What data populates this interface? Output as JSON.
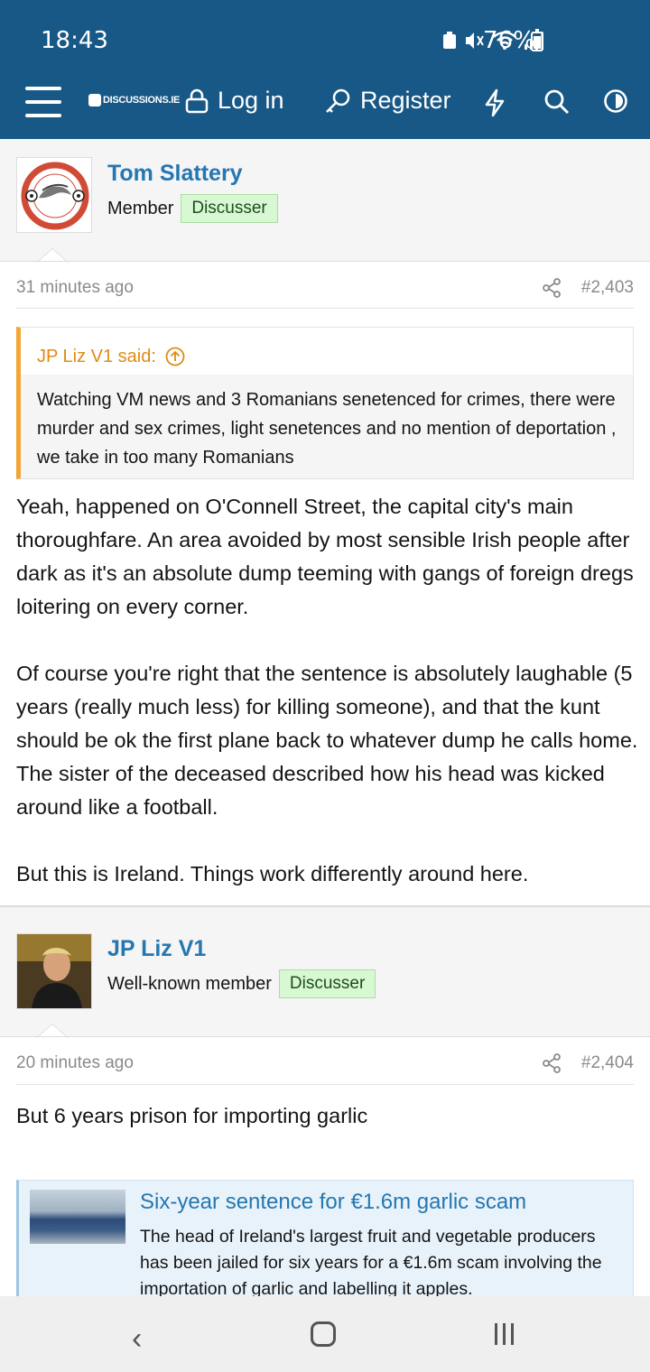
{
  "status_bar": {
    "time": "18:43",
    "battery": "76%"
  },
  "nav": {
    "brand": "DISCUSSIONS.IE",
    "login": "Log in",
    "register": "Register"
  },
  "posts": [
    {
      "username": "Tom Slattery",
      "role": "Member",
      "badge": "Discusser",
      "time": "31 minutes ago",
      "number": "#2,403",
      "quote": {
        "author": "JP Liz V1 said:",
        "text": "Watching VM news and 3 Romanians senetenced for crimes, there were murder and sex crimes, light senetences and no mention of deportation , we take in too many Romanians"
      },
      "paragraphs": [
        "Yeah, happened on O'Connell Street, the capital city's main thoroughfare. An area avoided by most sensible Irish people after dark as it's an absolute dump teeming with gangs of foreign dregs loitering on every corner.",
        "Of course you're right that the sentence is absolutely laughable (5 years (really much less) for killing someone), and that the kunt should be ok the first plane back to whatever dump he calls home. The sister of the deceased described how his head was kicked around like a football.",
        "But this is Ireland. Things work differently around here."
      ]
    },
    {
      "username": "JP Liz V1",
      "role": "Well-known member",
      "badge": "Discusser",
      "time": "20 minutes ago",
      "number": "#2,404",
      "paragraphs": [
        "But 6 years prison for importing garlic"
      ],
      "embed": {
        "title": "Six-year sentence for €1.6m garlic scam",
        "description": "The head of Ireland's largest fruit and vegetable producers has been jailed for six years for a €1.6m scam involving the importation of garlic and labelling it apples."
      }
    }
  ]
}
